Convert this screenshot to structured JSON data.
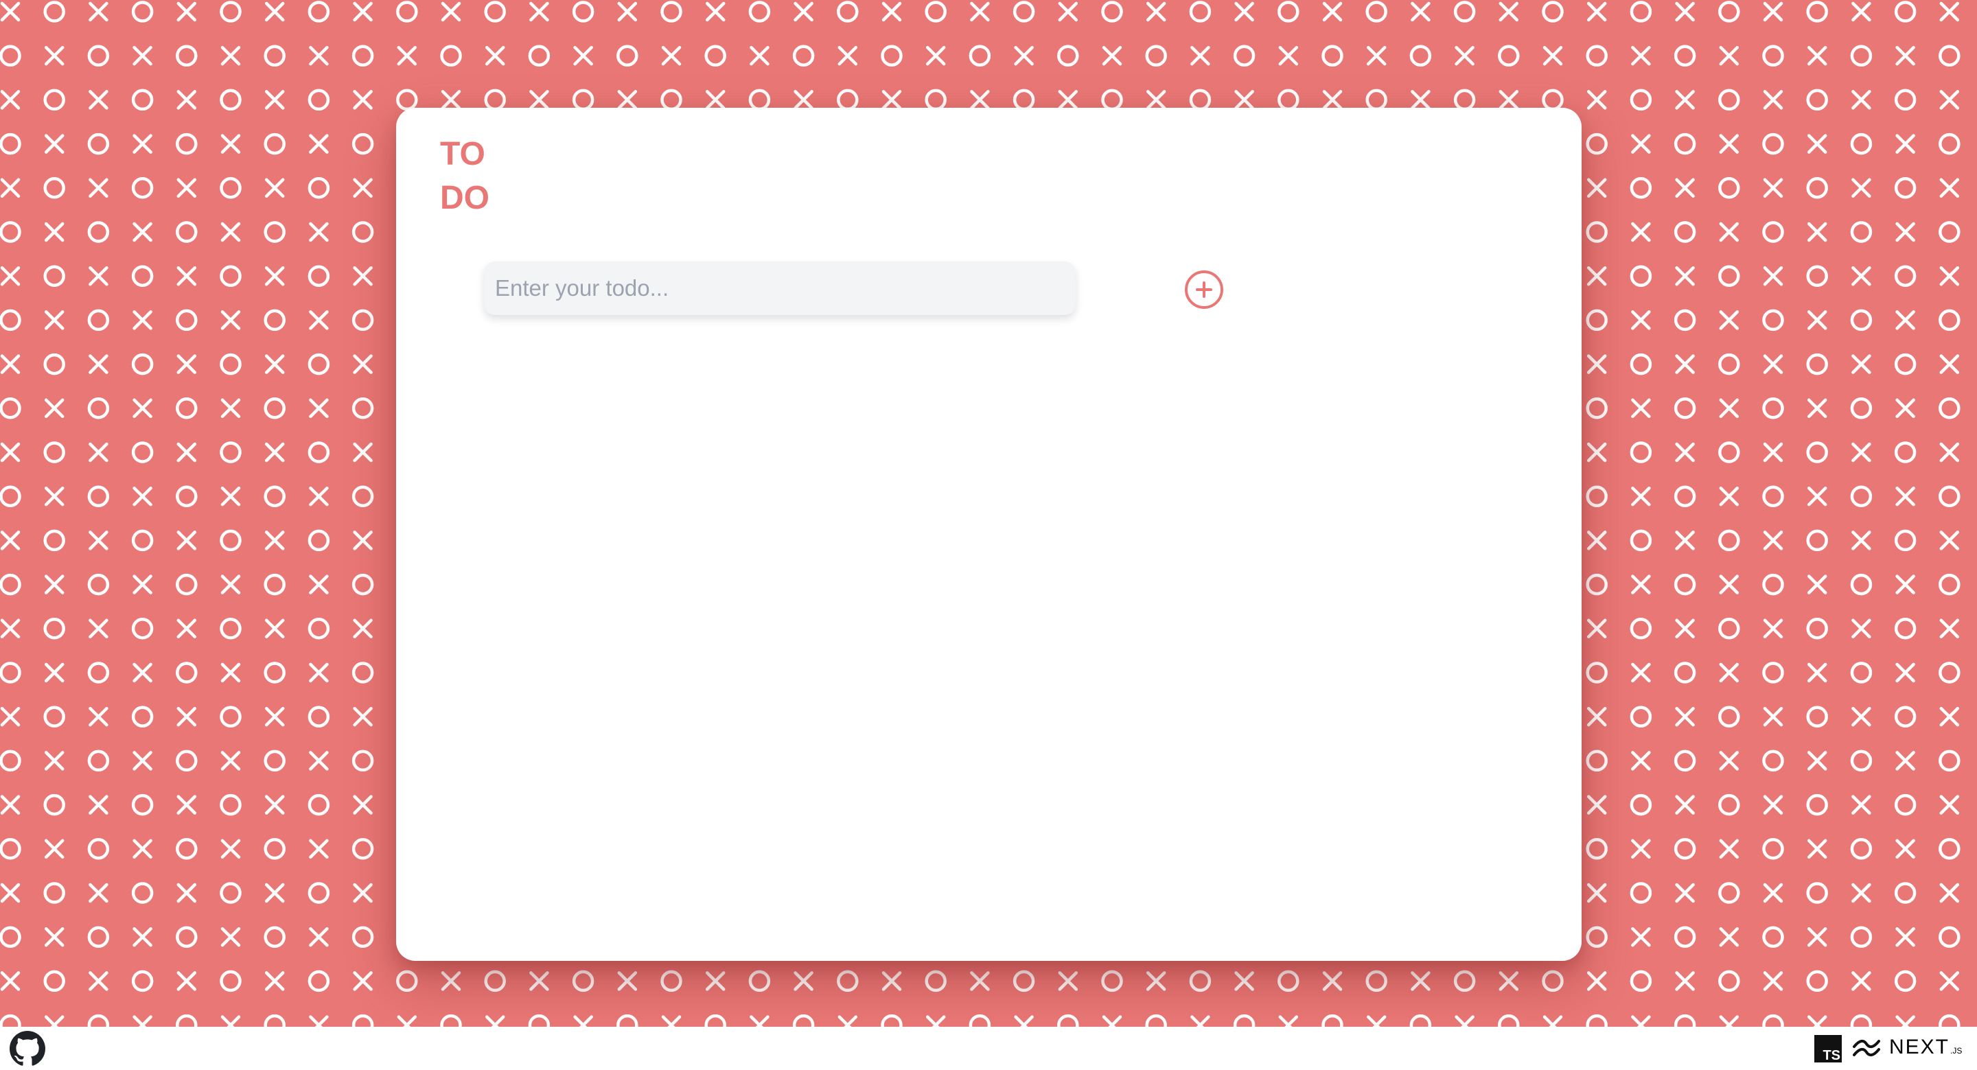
{
  "app": {
    "title_lines": [
      "TO",
      "DO"
    ]
  },
  "todo_form": {
    "input_value": "",
    "input_placeholder": "Enter your todo...",
    "add_button_icon": "plus-circle-icon"
  },
  "todos": [],
  "background": {
    "pattern_icons": [
      "x-icon",
      "circle-icon"
    ]
  },
  "footer": {
    "left_icons": [
      "github-icon"
    ],
    "right_icons": [
      "typescript-icon",
      "tailwind-icon",
      "nextjs-logo"
    ],
    "typescript_badge_text": "TS",
    "nextjs_logo_text": "NEXT",
    "nextjs_logo_suffix": ".JS"
  },
  "colors": {
    "accent": "#e87775",
    "pattern_stroke": "#ffffff",
    "card_background": "#ffffff",
    "input_background": "#f3f4f6",
    "placeholder_text": "#9ca3af"
  }
}
